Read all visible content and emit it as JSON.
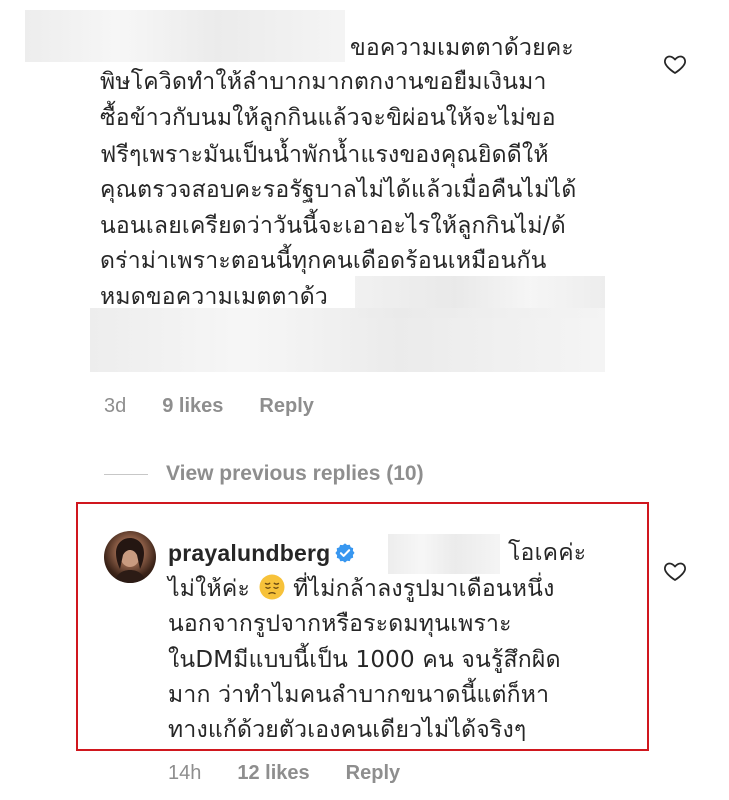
{
  "comment1": {
    "lines": [
      "ขอความเมตตาด้วยคะ",
      "พิษโควิดทำให้ลำบากมากตกงานขอยืมเงินมา",
      "ซื้อข้าวกับนมให้ลูกกินแล้วจะขิผ่อนให้จะไม่ขอ",
      "ฟรีๆเพราะมันเป็นน้ำพักน้ำแรงของคุณยิดดีให้",
      "คุณตรวจสอบคะรอรัฐบาลไม่ได้แล้วเมื่อคืนไม่ได้",
      "นอนเลยเครียดว่าวันนี้จะเอาอะไรให้ลูกกินไม่/ด้",
      "ดร่าม่าเพราะตอนนี้ทุกคนเดือดร้อนเหมือนกัน",
      "หมดขอความเมตตาด้ว"
    ],
    "time": "3d",
    "likes": "9 likes",
    "reply": "Reply"
  },
  "view_previous": "View previous replies (10)",
  "comment2": {
    "username": "prayalundberg",
    "first_text": "โอเคค่ะ",
    "line2_a": "ไม่ให้ค่ะ",
    "line2_b": "ที่ไม่กล้าลงรูปมาเดือนหนึ่ง",
    "lines": [
      "นอกจากรูปจากหรือระดมทุนเพราะ",
      "ในDMมีแบบนี้เป็น 1000 คน จนรู้สึกผิด",
      "มาก ว่าทำไมคนลำบากขนาดนี้แต่ก็หา",
      "ทางแก้ด้วยตัวเองคนเดียวไม่ได้จริงๆ"
    ],
    "time": "14h",
    "likes": "12 likes",
    "reply": "Reply"
  },
  "icons": {
    "like": "heart-outline-icon",
    "verified": "verified-badge-icon",
    "emoji": "pensive-face-emoji"
  },
  "colors": {
    "highlight_border": "#d0171e",
    "verified_blue": "#3897f0",
    "secondary_text": "#8e8e8e"
  }
}
